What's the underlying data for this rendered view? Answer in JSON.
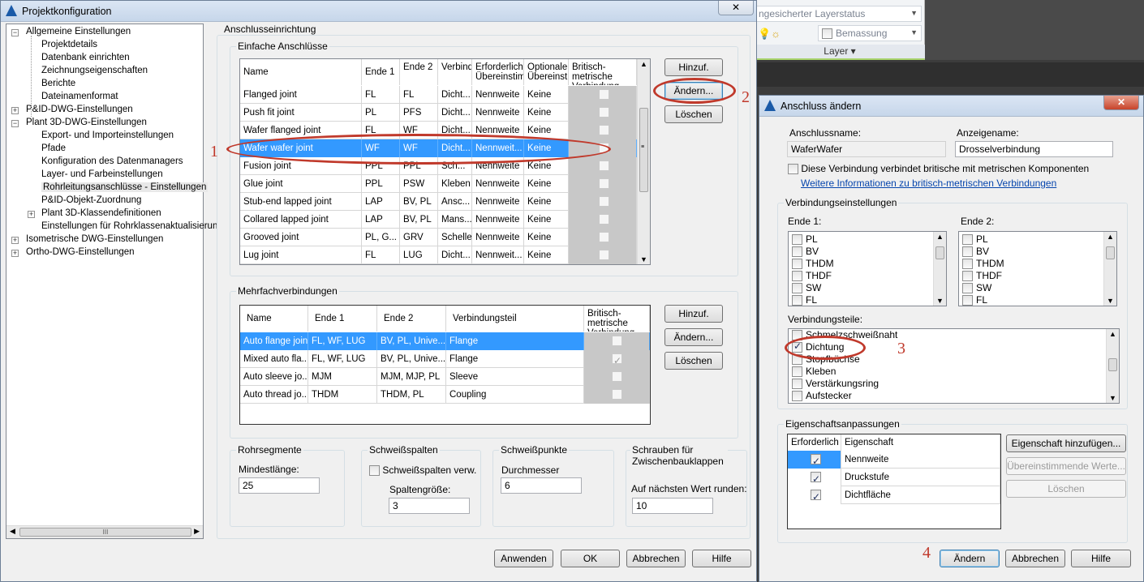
{
  "main": {
    "title": "Projektkonfiguration",
    "close": "✕"
  },
  "tree": [
    {
      "label": "Allgemeine Einstellungen",
      "exp": "−"
    },
    {
      "label": "Projektdetails"
    },
    {
      "label": "Datenbank einrichten"
    },
    {
      "label": "Zeichnungseigenschaften"
    },
    {
      "label": "Berichte"
    },
    {
      "label": "Dateinamenformat"
    },
    {
      "label": "P&ID-DWG-Einstellungen",
      "exp": "+"
    },
    {
      "label": "Plant 3D-DWG-Einstellungen",
      "exp": "−"
    },
    {
      "label": "Export- und Importeinstellungen"
    },
    {
      "label": "Pfade"
    },
    {
      "label": "Konfiguration des Datenmanagers"
    },
    {
      "label": "Layer- und Farbeinstellungen"
    },
    {
      "label": "Rohrleitungsanschlüsse - Einstellungen"
    },
    {
      "label": "P&ID-Objekt-Zuordnung"
    },
    {
      "label": "Plant 3D-Klassendefinitionen",
      "exp": "+"
    },
    {
      "label": "Einstellungen für Rohrklassenaktualisierun"
    },
    {
      "label": "Isometrische DWG-Einstellungen",
      "exp": "+"
    },
    {
      "label": "Ortho-DWG-Einstellungen",
      "exp": "+"
    }
  ],
  "tree_hscroll": "III",
  "section": "Anschlusseinrichtung",
  "simple": {
    "legend": "Einfache Anschlüsse",
    "headers": [
      "Name",
      "Ende 1",
      "Ende 2",
      "Verbindungsteil",
      "Erforderliche Übereinstimmung",
      "Optionale Übereinstimmung",
      "Britisch-metrische Verbindung"
    ],
    "rows": [
      [
        "Flanged joint",
        "FL",
        "FL",
        "Dicht...",
        "Nennweite",
        "Keine",
        false
      ],
      [
        "Push fit joint",
        "PL",
        "PFS",
        "Dicht...",
        "Nennweite",
        "Keine",
        false
      ],
      [
        "Wafer flanged joint",
        "FL",
        "WF",
        "Dicht...",
        "Nennweite",
        "Keine",
        false
      ],
      [
        "Wafer wafer joint",
        "WF",
        "WF",
        "Dicht...",
        "Nennweit...",
        "Keine",
        false
      ],
      [
        "Fusion joint",
        "PPL",
        "PPL",
        "Sch...",
        "Nennweite",
        "Keine",
        false
      ],
      [
        "Glue joint",
        "PPL",
        "PSW",
        "Kleben",
        "Nennweite",
        "Keine",
        false
      ],
      [
        "Stub-end lapped joint",
        "LAP",
        "BV, PL",
        "Ansc...",
        "Nennweite",
        "Keine",
        false
      ],
      [
        "Collared lapped joint",
        "LAP",
        "BV, PL",
        "Mans...",
        "Nennweite",
        "Keine",
        false
      ],
      [
        "Grooved joint",
        "PL, G...",
        "GRV",
        "Schelle",
        "Nennweite",
        "Keine",
        false
      ],
      [
        "Lug joint",
        "FL",
        "LUG",
        "Dicht...",
        "Nennweit...",
        "Keine",
        false
      ]
    ],
    "buttons": [
      "Hinzuf.",
      "Ändern...",
      "Löschen"
    ]
  },
  "multi": {
    "legend": "Mehrfachverbindungen",
    "headers": [
      "Name",
      "Ende 1",
      "Ende 2",
      "Verbindungsteil",
      "Britisch-metrische Verbindung"
    ],
    "rows": [
      [
        "Auto flange joint",
        "FL, WF, LUG",
        "BV, PL, Unive...",
        "Flange",
        false
      ],
      [
        "Mixed auto fla...",
        "FL, WF, LUG",
        "BV, PL, Unive...",
        "Flange",
        true
      ],
      [
        "Auto sleeve jo...",
        "MJM",
        "MJM, MJP, PL",
        "Sleeve",
        false
      ],
      [
        "Auto thread jo...",
        "THDM",
        "THDM, PL",
        "Coupling",
        false
      ]
    ],
    "buttons": [
      "Hinzuf.",
      "Ändern...",
      "Löschen"
    ]
  },
  "rohr": {
    "legend": "Rohrsegmente",
    "label": "Mindestlänge:",
    "value": "25"
  },
  "schweiss": {
    "legend": "Schweißspalten",
    "check": "Schweißspalten verw.",
    "label": "Spaltengröße:",
    "value": "3"
  },
  "punkte": {
    "legend": "Schweißpunkte",
    "label": "Durchmesser",
    "value": "6"
  },
  "schrauben": {
    "legend": "Schrauben für Zwischenbauklappen",
    "label": "Auf nächsten Wert runden:",
    "value": "10"
  },
  "main_buttons": [
    "Anwenden",
    "OK",
    "Abbrechen",
    "Hilfe"
  ],
  "ribbon": {
    "layerstate": "ngesicherter Layerstatus",
    "bemassung": "Bemassung",
    "panel": "Layer"
  },
  "dlg": {
    "title": "Anschluss ändern",
    "close": "✕",
    "name_label": "Anschlussname:",
    "name_value": "WaferWafer",
    "disp_label": "Anzeigename:",
    "disp_value": "Drosselverbindung",
    "brit_check": "Diese Verbindung verbindet britische mit metrischen Komponenten",
    "link": "Weitere Informationen zu britisch-metrischen Verbindungen",
    "conn_legend": "Verbindungseinstellungen",
    "end1_label": "Ende 1:",
    "end2_label": "Ende 2:",
    "ends": [
      "PL",
      "BV",
      "THDM",
      "THDF",
      "SW",
      "FL"
    ],
    "parts_label": "Verbindungsteile:",
    "parts": [
      {
        "label": "Schmelzschweißnaht",
        "checked": false
      },
      {
        "label": "Dichtung",
        "checked": true
      },
      {
        "label": "Stopfbüchse",
        "checked": false
      },
      {
        "label": "Kleben",
        "checked": false
      },
      {
        "label": "Verstärkungsring",
        "checked": false
      },
      {
        "label": "Aufstecker",
        "checked": false
      }
    ],
    "props_legend": "Eigenschaftsanpassungen",
    "props_headers": [
      "Erforderlich",
      "Eigenschaft"
    ],
    "props": [
      {
        "name": "Nennweite",
        "checked": true
      },
      {
        "name": "Druckstufe",
        "checked": true
      },
      {
        "name": "Dichtfläche",
        "checked": true
      }
    ],
    "prop_buttons": [
      "Eigenschaft hinzufügen...",
      "Übereinstimmende Werte...",
      "Löschen"
    ],
    "buttons": [
      "Ändern",
      "Abbrechen",
      "Hilfe"
    ]
  },
  "annotations": [
    "1",
    "2",
    "3",
    "4"
  ]
}
